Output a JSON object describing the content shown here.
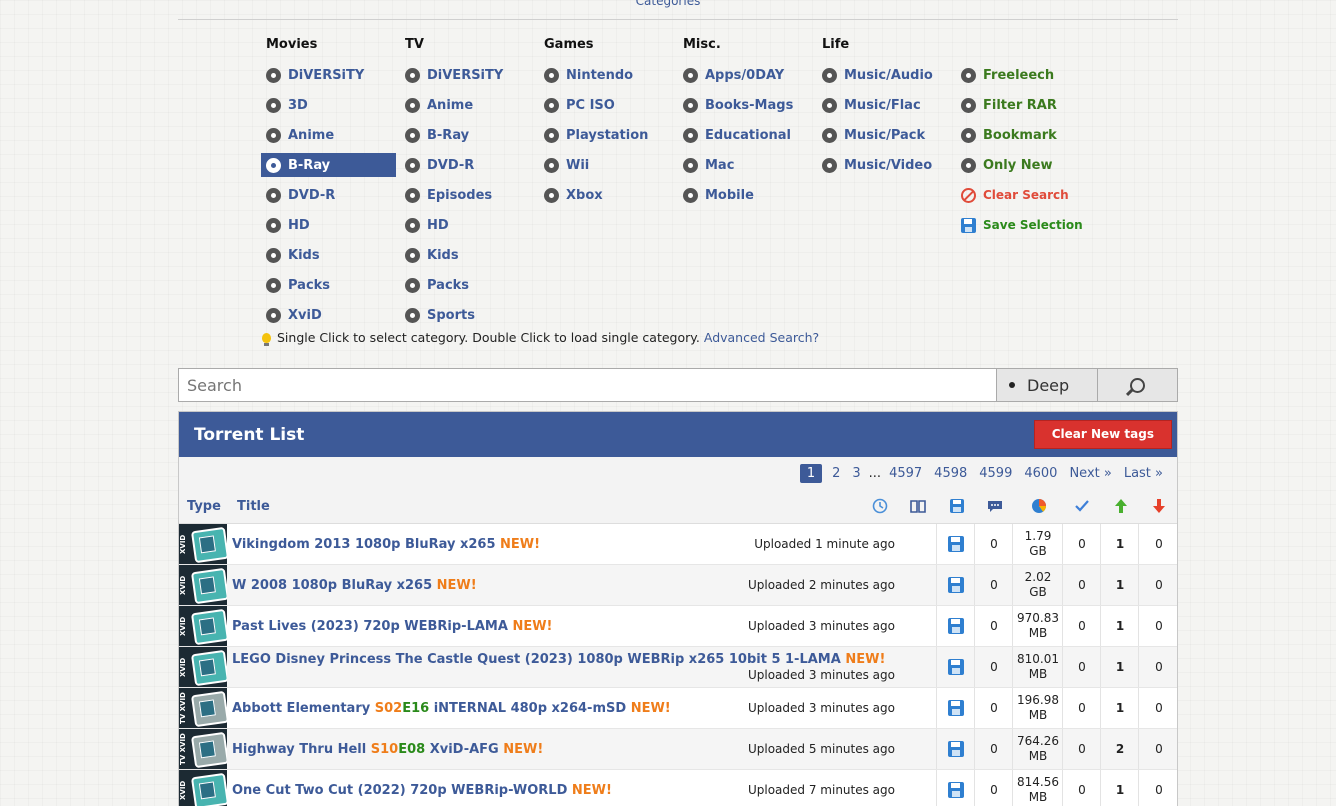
{
  "categories_header": "Categories",
  "categories": {
    "movies": {
      "title": "Movies",
      "items": [
        "DiVERSiTY",
        "3D",
        "Anime",
        "B-Ray",
        "DVD-R",
        "HD",
        "Kids",
        "Packs",
        "XviD"
      ],
      "selected": "B-Ray"
    },
    "tv": {
      "title": "TV",
      "items": [
        "DiVERSiTY",
        "Anime",
        "B-Ray",
        "DVD-R",
        "Episodes",
        "HD",
        "Kids",
        "Packs",
        "Sports"
      ]
    },
    "games": {
      "title": "Games",
      "items": [
        "Nintendo",
        "PC ISO",
        "Playstation",
        "Wii",
        "Xbox"
      ]
    },
    "misc": {
      "title": "Misc.",
      "items": [
        "Apps/0DAY",
        "Books-Mags",
        "Educational",
        "Mac",
        "Mobile"
      ]
    },
    "life": {
      "title": "Life",
      "items": [
        "Music/Audio",
        "Music/Flac",
        "Music/Pack",
        "Music/Video"
      ]
    },
    "filters": {
      "items": [
        "Freeleech",
        "Filter RAR",
        "Bookmark",
        "Only New"
      ],
      "clear_search": "Clear Search",
      "save_selection": "Save Selection"
    }
  },
  "hint": {
    "text": "Single Click to select category. Double Click to load single category.",
    "link": "Advanced Search?"
  },
  "search": {
    "placeholder": "Search",
    "deep_label": "Deep"
  },
  "torrent_list": {
    "title": "Torrent List",
    "clear_new_tags": "Clear New tags",
    "pagination": {
      "current": "1",
      "pages": [
        "2",
        "3"
      ],
      "ellipsis": "...",
      "tail": [
        "4597",
        "4598",
        "4599",
        "4600"
      ],
      "next": "Next »",
      "last": "Last »"
    },
    "columns": {
      "type": "Type",
      "title": "Title"
    },
    "column_icons": [
      "clock-icon",
      "book-icon",
      "save-icon",
      "comment-icon",
      "pie-icon",
      "check-icon",
      "up-arrow-icon",
      "down-arrow-icon"
    ],
    "rows": [
      {
        "type": "XVID",
        "title": "Vikingdom 2013 1080p BluRay x265",
        "new": "NEW!",
        "uploaded": "Uploaded 1 minute ago",
        "comments": "0",
        "size1": "1.79",
        "size2": "GB",
        "snatched": "0",
        "seeders": "1",
        "leechers": "0"
      },
      {
        "type": "XVID",
        "title": "W 2008 1080p BluRay x265",
        "new": "NEW!",
        "uploaded": "Uploaded 2 minutes ago",
        "comments": "0",
        "size1": "2.02",
        "size2": "GB",
        "snatched": "0",
        "seeders": "1",
        "leechers": "0"
      },
      {
        "type": "XVID",
        "title": "Past Lives (2023) 720p WEBRip-LAMA",
        "new": "NEW!",
        "uploaded": "Uploaded 3 minutes ago",
        "comments": "0",
        "size1": "970.83",
        "size2": "MB",
        "snatched": "0",
        "seeders": "1",
        "leechers": "0"
      },
      {
        "type": "XVID",
        "title": "LEGO Disney Princess The Castle Quest (2023) 1080p WEBRip x265 10bit 5 1-LAMA",
        "new": "NEW!",
        "uploaded": "Uploaded 3 minutes ago",
        "comments": "0",
        "size1": "810.01",
        "size2": "MB",
        "snatched": "0",
        "seeders": "1",
        "leechers": "0"
      },
      {
        "type": "TV XVID",
        "title_a": "Abbott Elementary",
        "season": "S02",
        "episode": "E16",
        "title_b": "iNTERNAL 480p x264-mSD",
        "new": "NEW!",
        "uploaded": "Uploaded 3 minutes ago",
        "comments": "0",
        "size1": "196.98",
        "size2": "MB",
        "snatched": "0",
        "seeders": "1",
        "leechers": "0"
      },
      {
        "type": "TV XVID",
        "title_a": "Highway Thru Hell",
        "season": "S10",
        "episode": "E08",
        "title_b": "XviD-AFG",
        "new": "NEW!",
        "uploaded": "Uploaded 5 minutes ago",
        "comments": "0",
        "size1": "764.26",
        "size2": "MB",
        "snatched": "0",
        "seeders": "2",
        "leechers": "0"
      },
      {
        "type": "XVID",
        "title": "One Cut Two Cut (2022) 720p WEBRip-WORLD",
        "new": "NEW!",
        "uploaded": "Uploaded 7 minutes ago",
        "comments": "0",
        "size1": "814.56",
        "size2": "MB",
        "snatched": "0",
        "seeders": "1",
        "leechers": "0"
      }
    ]
  },
  "colors": {
    "accent": "#3d5a98",
    "new": "#ef7d1a",
    "danger": "#d9322e",
    "green": "#2a8a1a"
  }
}
